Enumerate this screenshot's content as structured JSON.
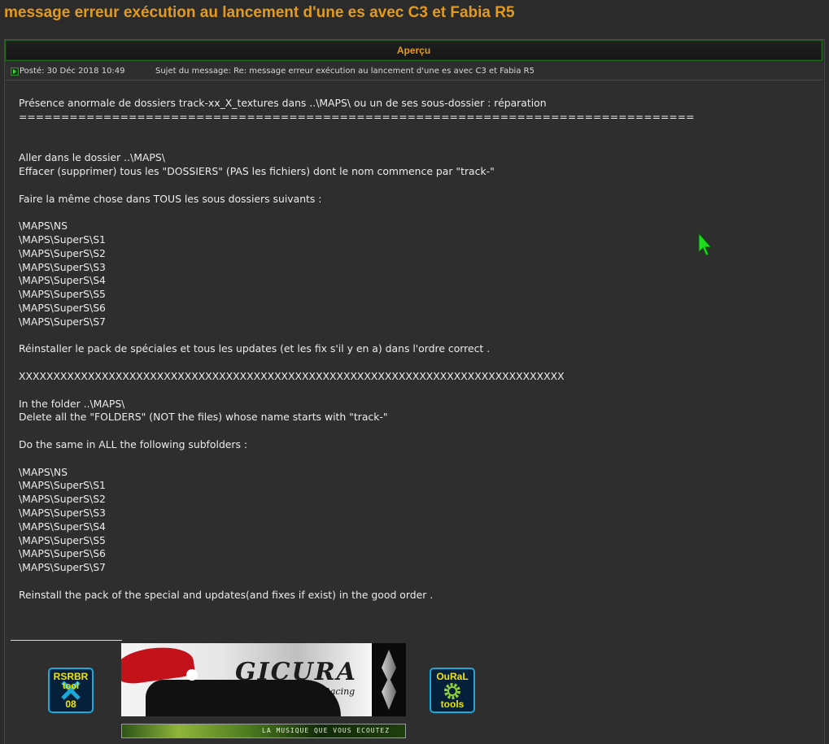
{
  "topic": {
    "title": "message erreur exécution au lancement d'une es avec C3 et Fabia R5"
  },
  "preview_bar": {
    "label": "Aperçu"
  },
  "meta": {
    "posted_label": "Posté:",
    "posted_date": "30 Déc 2018 10:49",
    "subject_label": "Sujet du message:",
    "subject_value": "Re: message erreur exécution au lancement d'une es avec C3 et Fabia R5"
  },
  "post": {
    "lines": [
      "Présence anormale de dossiers track-xx_X_textures dans ..\\MAPS\\ ou un de ses sous-dossier : réparation",
      "================================================================================",
      "",
      "",
      "Aller dans le dossier ..\\MAPS\\",
      "Effacer (supprimer) tous les \"DOSSIERS\" (PAS les fichiers) dont le nom commence par \"track-\"",
      "",
      "Faire la même chose dans TOUS les sous dossiers suivants :",
      "",
      "\\MAPS\\NS",
      "\\MAPS\\SuperS\\S1",
      "\\MAPS\\SuperS\\S2",
      "\\MAPS\\SuperS\\S3",
      "\\MAPS\\SuperS\\S4",
      "\\MAPS\\SuperS\\S5",
      "\\MAPS\\SuperS\\S6",
      "\\MAPS\\SuperS\\S7",
      "",
      "Réinstaller le pack de spéciales et tous les updates (et les fix s'il y en a) dans l'ordre correct .",
      "",
      "XXXXXXXXXXXXXXXXXXXXXXXXXXXXXXXXXXXXXXXXXXXXXXXXXXXXXXXXXXXXXXXXXXXXXXXXXXXXXXX",
      "",
      "In the folder ..\\MAPS\\",
      "Delete all the \"FOLDERS\" (NOT the files) whose name starts with \"track-\"",
      "",
      "Do the same in ALL the following subfolders :",
      "",
      "\\MAPS\\NS",
      "\\MAPS\\SuperS\\S1",
      "\\MAPS\\SuperS\\S2",
      "\\MAPS\\SuperS\\S3",
      "\\MAPS\\SuperS\\S4",
      "\\MAPS\\SuperS\\S5",
      "\\MAPS\\SuperS\\S6",
      "\\MAPS\\SuperS\\S7",
      "",
      "Reinstall the pack of the special and updates(and fixes if exist) in the good order ."
    ]
  },
  "signature": {
    "rsrbr_badge": {
      "top": "RSRBR",
      "middle": "tool",
      "bottom": "08"
    },
    "oural_badge": {
      "top": "OuRaL",
      "bottom": "tools"
    },
    "banner": {
      "logo": "GICURA",
      "tagline": "Gibson Custom Racing"
    },
    "music_bar": "LA MUSIQUE QUE VOUS ECOUTEZ"
  },
  "colors": {
    "accent": "#e39a1d",
    "background": "#2b2b2b",
    "border_green": "#1e6b1e",
    "cursor": "#1fdc1f"
  },
  "icons": {
    "post": "post-arrow-icon",
    "cursor": "mouse-cursor-icon"
  }
}
